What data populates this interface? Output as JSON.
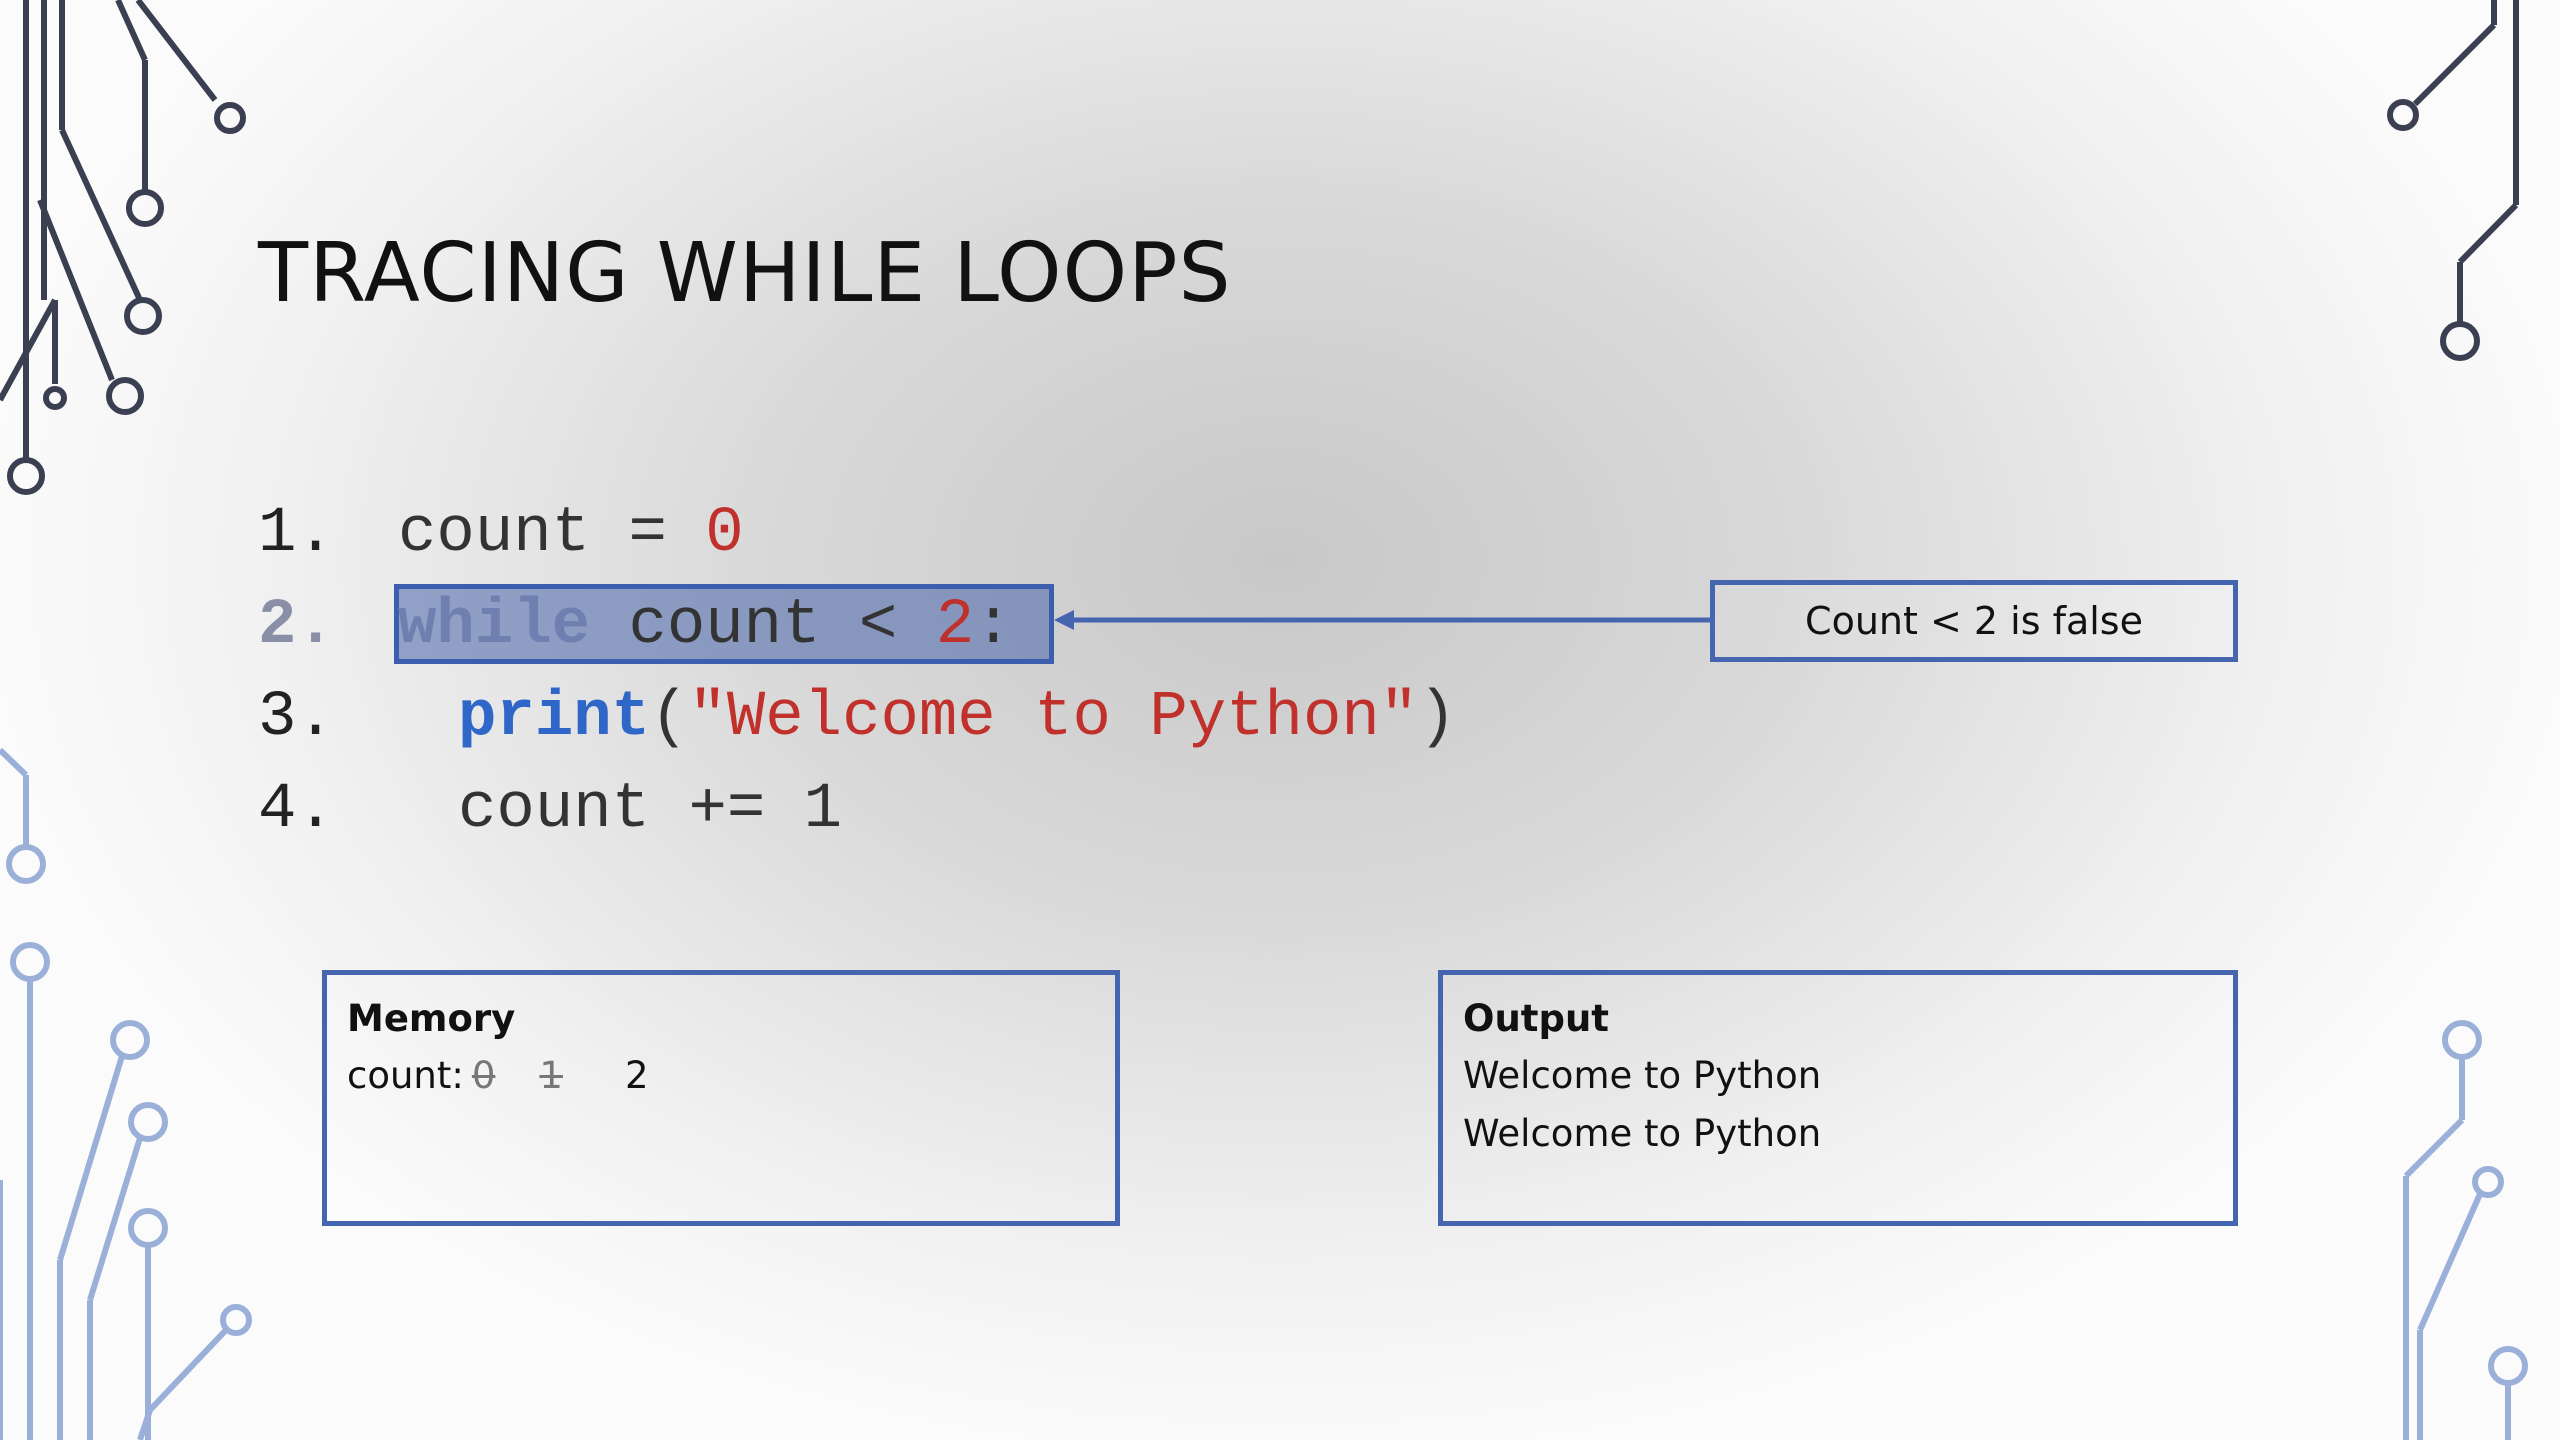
{
  "slide": {
    "title": "TRACING WHILE LOOPS"
  },
  "code": {
    "lines": [
      {
        "num": "1.",
        "parts": [
          "count = ",
          "0"
        ]
      },
      {
        "num": "2.",
        "keyword": "while",
        "rest": " count < ",
        "value": "2",
        "colon": ":"
      },
      {
        "num": "3.",
        "keyword": "print",
        "open": "(",
        "string": "\"Welcome to Python\"",
        "close": ")"
      },
      {
        "num": "4.",
        "text": "count += 1"
      }
    ],
    "highlighted_line": 2
  },
  "callout": {
    "text": "Count < 2 is false"
  },
  "memory": {
    "title": "Memory",
    "label": "count:",
    "old_values": [
      "0",
      "1"
    ],
    "current_value": "2"
  },
  "output": {
    "title": "Output",
    "lines": [
      "Welcome to Python",
      "Welcome to Python"
    ]
  },
  "colors": {
    "accent": "#4565b0",
    "keyword": "#2f67c9",
    "literal": "#c0312b"
  }
}
